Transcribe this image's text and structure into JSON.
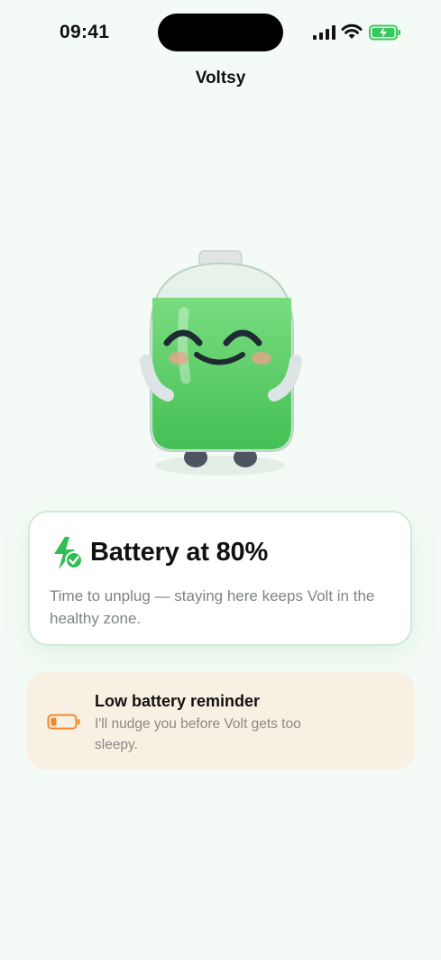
{
  "status_bar": {
    "time": "09:41",
    "icons": [
      "cellular-signal-icon",
      "wifi-icon",
      "battery-charging-icon"
    ],
    "battery_color": "#36c95b"
  },
  "app": {
    "title": "Voltsy"
  },
  "mascot": {
    "name": "Volt",
    "charge_fraction": 0.8,
    "fill_color": "#5ed36c",
    "mood": "happy"
  },
  "battery_card": {
    "icon": "bolt-check-icon",
    "title": "Battery at 80%",
    "body": "Time to unplug — staying here keeps Volt in the healthy zone.",
    "accent_color": "#2fbe55"
  },
  "reminder_card": {
    "icon": "low-battery-icon",
    "title": "Low battery reminder",
    "body": "I'll nudge you before Volt gets too sleepy.",
    "accent_color": "#f08a2c"
  }
}
